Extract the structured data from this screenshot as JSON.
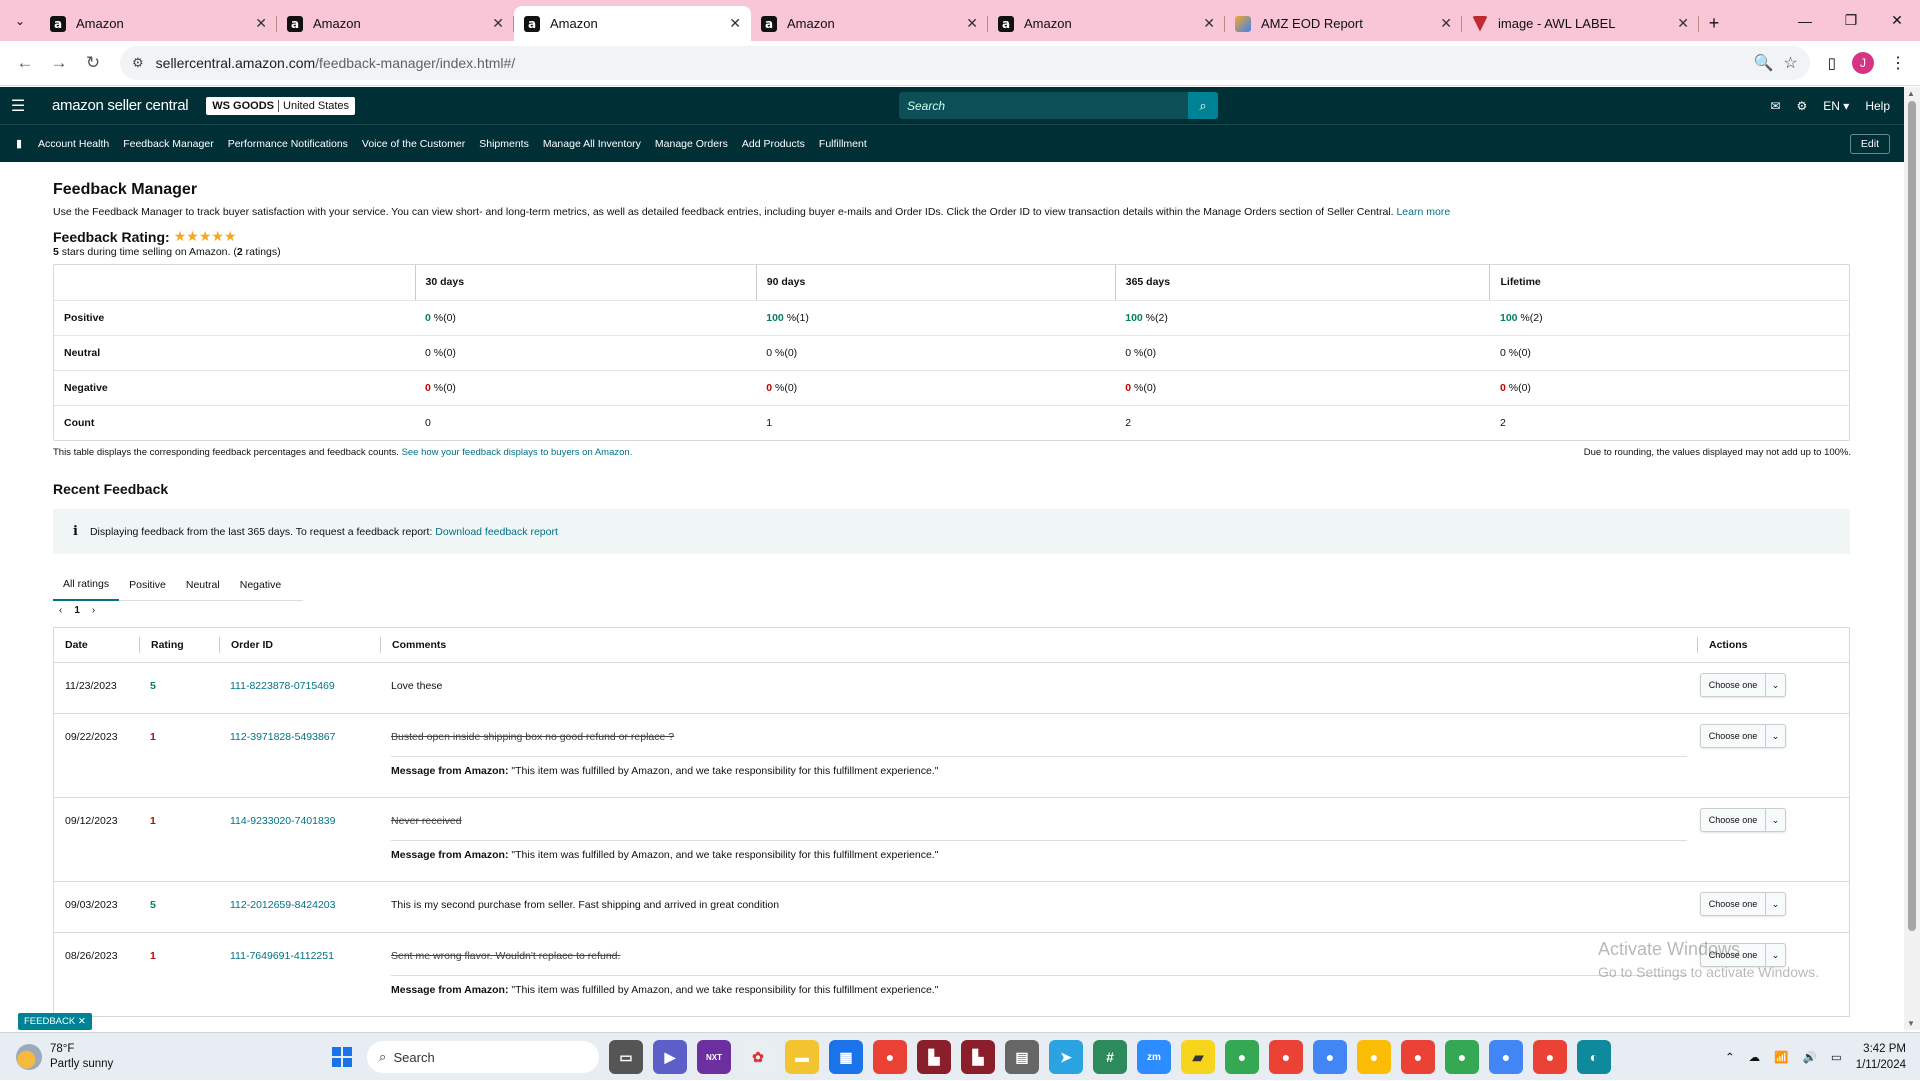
{
  "browser": {
    "tabs": [
      {
        "title": "Amazon",
        "icon": "amazon-icon",
        "active": false
      },
      {
        "title": "Amazon",
        "icon": "amazon-icon",
        "active": false
      },
      {
        "title": "Amazon",
        "icon": "amazon-icon",
        "active": true
      },
      {
        "title": "Amazon",
        "icon": "amazon-icon",
        "active": false
      },
      {
        "title": "Amazon",
        "icon": "amazon-icon",
        "active": false
      },
      {
        "title": "AMZ EOD Report",
        "icon": "report-icon",
        "active": false
      },
      {
        "title": "image - AWL LABEL",
        "icon": "awl-icon",
        "active": false
      }
    ],
    "url_host": "sellercentral.amazon.com",
    "url_path": "/feedback-manager/index.html#/",
    "profile_initial": "J"
  },
  "header": {
    "logo_text": "amazon seller central",
    "store_name": "WS GOODS",
    "store_region": "United States",
    "search_placeholder": "Search",
    "language": "EN",
    "help": "Help"
  },
  "nav": {
    "items": [
      "Account Health",
      "Feedback Manager",
      "Performance Notifications",
      "Voice of the Customer",
      "Shipments",
      "Manage All Inventory",
      "Manage Orders",
      "Add Products",
      "Fulfillment"
    ],
    "edit_label": "Edit"
  },
  "page": {
    "title": "Feedback Manager",
    "description": "Use the Feedback Manager to track buyer satisfaction with your service. You can view short- and long-term metrics, as well as detailed feedback entries, including buyer e-mails and Order IDs. Click the Order ID to view transaction details within the Manage Orders section of Seller Central.",
    "learn_more": "Learn more",
    "rating_label": "Feedback Rating:",
    "stars": 5,
    "rating_sub_stars": "5",
    "rating_sub_mid": " stars during time selling on Amazon. (",
    "rating_sub_count": "2",
    "rating_sub_end": " ratings)"
  },
  "summary": {
    "headers": [
      "",
      "30 days",
      "90 days",
      "365 days",
      "Lifetime"
    ],
    "rows": [
      {
        "label": "Positive",
        "cells": [
          [
            "0",
            " %(0)"
          ],
          [
            "100",
            " %(1)"
          ],
          [
            "100",
            " %(2)"
          ],
          [
            "100",
            " %(2)"
          ]
        ]
      },
      {
        "label": "Neutral",
        "cells": [
          [
            "0",
            " %(0)"
          ],
          [
            "0",
            " %(0)"
          ],
          [
            "0",
            " %(0)"
          ],
          [
            "0",
            " %(0)"
          ]
        ]
      },
      {
        "label": "Negative",
        "cells": [
          [
            "0",
            " %(0)"
          ],
          [
            "0",
            " %(0)"
          ],
          [
            "0",
            " %(0)"
          ],
          [
            "0",
            " %(0)"
          ]
        ]
      },
      {
        "label": "Count",
        "cells": [
          [
            "0",
            ""
          ],
          [
            "1",
            ""
          ],
          [
            "2",
            ""
          ],
          [
            "2",
            ""
          ]
        ]
      }
    ],
    "note_left": "This table displays the corresponding feedback percentages and feedback counts.",
    "note_left_link": "See how your feedback displays to buyers on Amazon.",
    "note_right": "Due to rounding, the values displayed may not add up to 100%."
  },
  "recent": {
    "title": "Recent Feedback",
    "info_text": "Displaying feedback from the last 365 days. To request a feedback report:",
    "info_link": "Download feedback report",
    "tabs": [
      "All ratings",
      "Positive",
      "Neutral",
      "Negative"
    ],
    "page": "1",
    "columns": [
      "Date",
      "Rating",
      "Order ID",
      "Comments",
      "Actions"
    ],
    "msg_label": "Message from Amazon:",
    "msg_text": " \"This item was fulfilled by Amazon, and we take responsibility for this fulfillment experience.\"",
    "action_label": "Choose one",
    "rows": [
      {
        "date": "11/23/2023",
        "rating": "5",
        "order": "111-8223878-0715469",
        "comment": "Love these",
        "struck": false
      },
      {
        "date": "09/22/2023",
        "rating": "1",
        "order": "112-3971828-5493867",
        "comment": "Busted open inside shipping box no good refund or replace ?",
        "struck": true
      },
      {
        "date": "09/12/2023",
        "rating": "1",
        "order": "114-9233020-7401839",
        "comment": "Never received",
        "struck": true
      },
      {
        "date": "09/03/2023",
        "rating": "5",
        "order": "112-2012659-8424203",
        "comment": "This is my second purchase from seller. Fast shipping and arrived in great condition",
        "struck": false
      },
      {
        "date": "08/26/2023",
        "rating": "1",
        "order": "111-7649691-4112251",
        "comment": "Sent me wrong flavor. Wouldn't replace to refund.",
        "struck": true
      }
    ]
  },
  "overlay": {
    "watermark_title": "Activate Windows",
    "watermark_sub": "Go to Settings to activate Windows.",
    "feedback_tab": "FEEDBACK"
  },
  "taskbar": {
    "temp": "78°F",
    "weather": "Partly sunny",
    "search": "Search",
    "time": "3:42 PM",
    "date": "1/11/2024"
  },
  "colors": {
    "header_bg": "#002f36",
    "link": "#007185",
    "positive": "#067d62",
    "negative": "#c40000",
    "tab_strip": "#f8c6d6"
  }
}
